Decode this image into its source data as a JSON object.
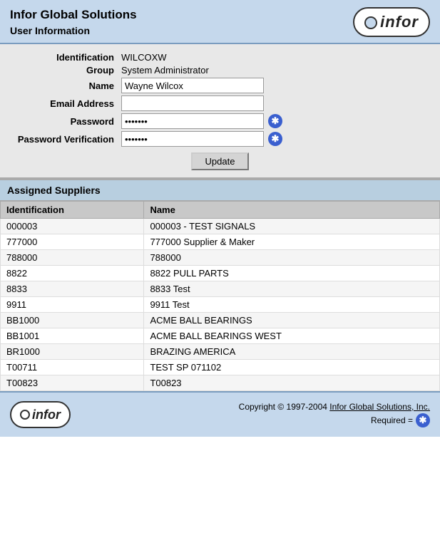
{
  "header": {
    "app_name": "Infor Global Solutions",
    "section_title": "User Information",
    "logo_text": "infor"
  },
  "user_info": {
    "identification_label": "Identification",
    "identification_value": "WILCOXW",
    "group_label": "Group",
    "group_value": "System Administrator",
    "name_label": "Name",
    "name_value": "Wayne Wilcox",
    "email_label": "Email Address",
    "email_value": "",
    "password_label": "Password",
    "password_value": "●●●●●●●",
    "password_verify_label": "Password Verification",
    "password_verify_value": "●●●●●●●",
    "update_button": "Update"
  },
  "suppliers": {
    "section_title": "Assigned Suppliers",
    "col_id": "Identification",
    "col_name": "Name",
    "rows": [
      {
        "id": "000003",
        "name": "000003 - TEST SIGNALS"
      },
      {
        "id": "777000",
        "name": "777000 Supplier & Maker"
      },
      {
        "id": "788000",
        "name": "788000"
      },
      {
        "id": "8822",
        "name": "8822 PULL PARTS"
      },
      {
        "id": "8833",
        "name": "8833 Test"
      },
      {
        "id": "9911",
        "name": "9911 Test"
      },
      {
        "id": "BB1000",
        "name": "ACME BALL BEARINGS"
      },
      {
        "id": "BB1001",
        "name": "ACME BALL BEARINGS WEST"
      },
      {
        "id": "BR1000",
        "name": "BRAZING AMERICA"
      },
      {
        "id": "T00711",
        "name": "TEST SP 071102"
      },
      {
        "id": "T00823",
        "name": "T00823"
      }
    ]
  },
  "footer": {
    "logo_text": "infor",
    "copyright": "Copyright © 1997-2004 Infor Global Solutions, Inc.",
    "required_label": "Required =",
    "link_text": "Infor Global Solutions, Inc."
  }
}
